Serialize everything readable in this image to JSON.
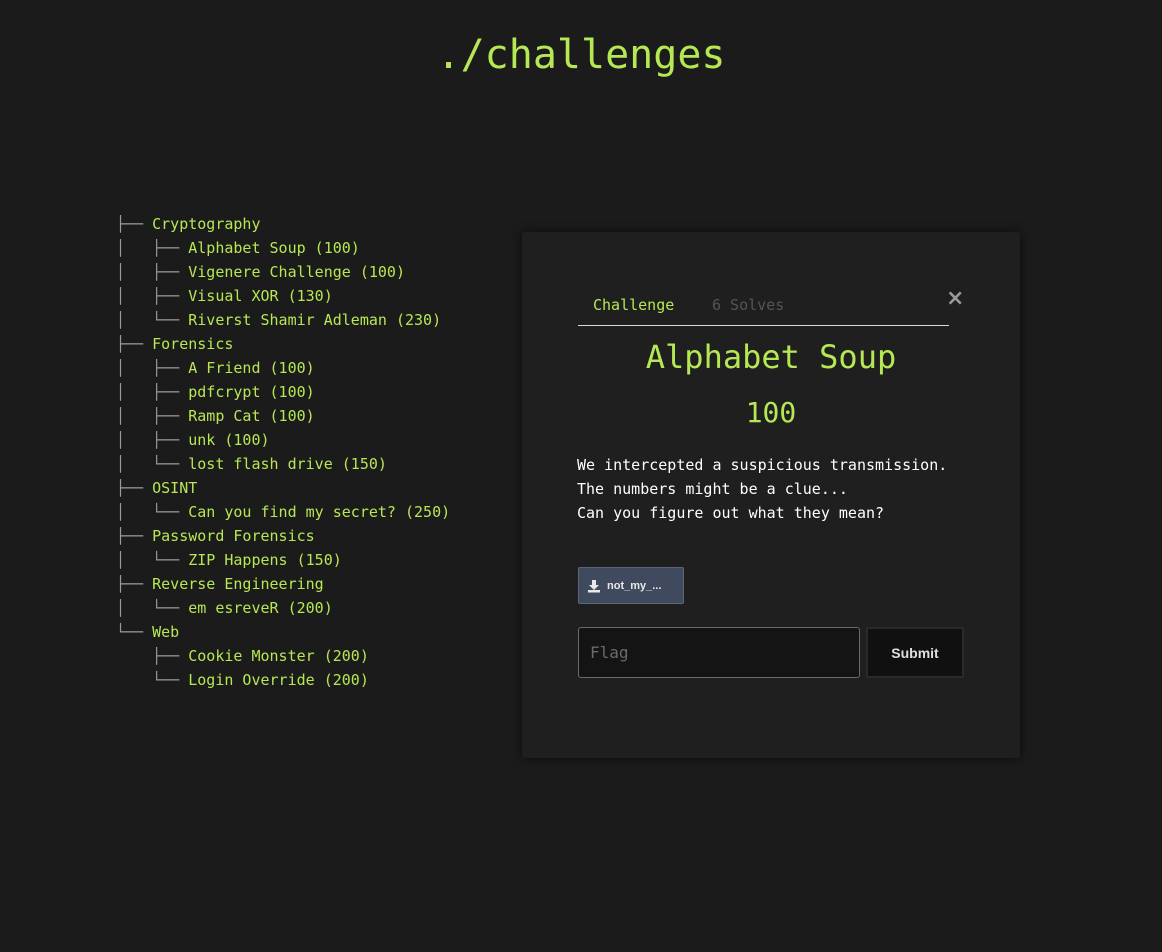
{
  "page": {
    "title": "./challenges"
  },
  "colors": {
    "background": "#1b1b1b",
    "accent_green": "#b5e853",
    "tree_branch": "#9a9a9a",
    "modal_bg": "#1f1f1f",
    "file_button": "#3f4a5e"
  },
  "tree": {
    "rows": [
      {
        "branch": "├── ",
        "label": "Cryptography",
        "kind": "category"
      },
      {
        "branch": "│   ├── ",
        "label": "Alphabet Soup (100)",
        "kind": "challenge"
      },
      {
        "branch": "│   ├── ",
        "label": "Vigenere Challenge (100)",
        "kind": "challenge"
      },
      {
        "branch": "│   ├── ",
        "label": "Visual XOR (130)",
        "kind": "challenge"
      },
      {
        "branch": "│   └── ",
        "label": "Riverst Shamir Adleman (230)",
        "kind": "challenge"
      },
      {
        "branch": "├── ",
        "label": "Forensics",
        "kind": "category"
      },
      {
        "branch": "│   ├── ",
        "label": "A Friend (100)",
        "kind": "challenge"
      },
      {
        "branch": "│   ├── ",
        "label": "pdfcrypt (100)",
        "kind": "challenge"
      },
      {
        "branch": "│   ├── ",
        "label": "Ramp Cat (100)",
        "kind": "challenge"
      },
      {
        "branch": "│   ├── ",
        "label": "unk (100)",
        "kind": "challenge"
      },
      {
        "branch": "│   └── ",
        "label": "lost flash drive (150)",
        "kind": "challenge"
      },
      {
        "branch": "├── ",
        "label": "OSINT",
        "kind": "category"
      },
      {
        "branch": "│   └── ",
        "label": "Can you find my secret? (250)",
        "kind": "challenge"
      },
      {
        "branch": "├── ",
        "label": "Password Forensics",
        "kind": "category"
      },
      {
        "branch": "│   └── ",
        "label": "ZIP Happens (150)",
        "kind": "challenge"
      },
      {
        "branch": "├── ",
        "label": "Reverse Engineering",
        "kind": "category"
      },
      {
        "branch": "│   └── ",
        "label": "em esreveR (200)",
        "kind": "challenge"
      },
      {
        "branch": "└── ",
        "label": "Web",
        "kind": "category"
      },
      {
        "branch": "    ├── ",
        "label": "Cookie Monster (200)",
        "kind": "challenge"
      },
      {
        "branch": "    └── ",
        "label": "Login Override (200)",
        "kind": "challenge"
      }
    ]
  },
  "modal": {
    "close_icon": "×",
    "tabs": {
      "challenge": "Challenge",
      "solves": "6 Solves"
    },
    "challenge_name": "Alphabet Soup",
    "challenge_value": "100",
    "description_line1": "We intercepted a suspicious transmission. The numbers might be a clue...",
    "description_line2": "Can you figure out what they mean?",
    "file_label": "not_my_...",
    "file_icon": "download-icon",
    "flag_placeholder": "Flag",
    "submit_label": "Submit"
  }
}
